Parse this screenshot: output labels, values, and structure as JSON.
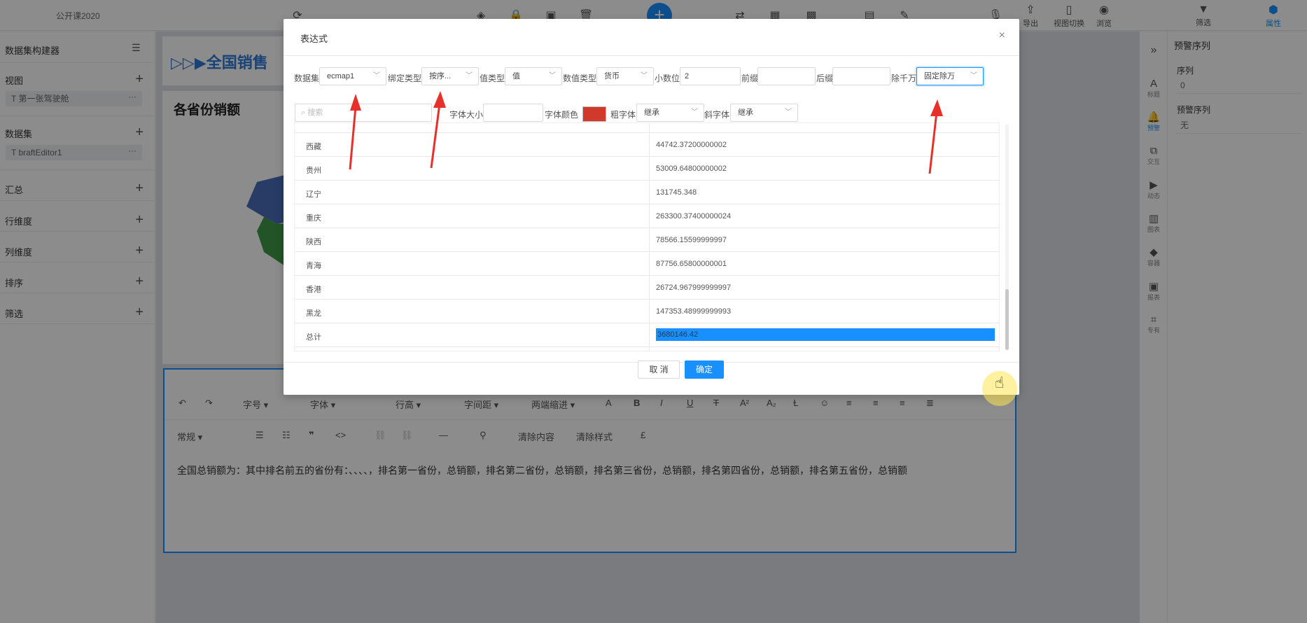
{
  "app": {
    "title": "公开课2020",
    "toolbar_right": [
      {
        "label": "导出"
      },
      {
        "label": "视图切换"
      },
      {
        "label": "浏览"
      },
      {
        "label": "筛选"
      },
      {
        "label": "属性"
      }
    ]
  },
  "left_panel": {
    "title": "数据集构建器",
    "sections": {
      "view": "视图",
      "view_item": "第一张驾驶舱",
      "dataset": "数据集",
      "dataset_item": "braftEditor1",
      "summary": "汇总",
      "row_dim": "行维度",
      "col_dim": "列维度",
      "sort": "排序",
      "filter": "筛选"
    }
  },
  "canvas": {
    "banner": "▷▷▶全国销售",
    "chart_title": "各省份销额"
  },
  "editor": {
    "toolbar_row1": [
      "字号",
      "字体",
      "行高",
      "字间距",
      "两端缩进"
    ],
    "toolbar_row2": [
      "常规",
      "清除内容",
      "清除样式"
    ],
    "content": "全国总销额为：其中排名前五的省份有：、、、、，排名第一省份，总销额，排名第二省份，总销额，排名第三省份，总销额，排名第四省份，总销额，排名第五省份，总销额"
  },
  "right_panel": {
    "title": "预警序列",
    "strip": [
      "标题",
      "预警",
      "交互",
      "动态",
      "图表",
      "容器",
      "报表",
      "专有"
    ],
    "fields": [
      {
        "label": "序列",
        "value": "0"
      },
      {
        "label": "预警序列",
        "value": "无"
      }
    ]
  },
  "modal": {
    "title": "表达式",
    "close_icon": "×",
    "fields": {
      "dataset_label": "数据集",
      "dataset_value": "ecmap1",
      "bind_label": "绑定类型",
      "bind_value": "按序...",
      "valuetype_label": "值类型",
      "valuetype_value": "值",
      "numtype_label": "数值类型",
      "numtype_value": "货币",
      "decimal_label": "小数位",
      "decimal_value": "2",
      "prefix_label": "前缀",
      "suffix_label": "后缀",
      "divide_label": "除千万",
      "divide_value": "固定除万",
      "search_placeholder": "搜索",
      "fontsize_label": "字体大小",
      "fontcolor_label": "字体颜色",
      "bold_label": "粗字体",
      "bold_value": "继承",
      "italic_label": "斜字体",
      "italic_value": "继承"
    },
    "rows": [
      {
        "name": "西藏",
        "value": "44742.37200000002"
      },
      {
        "name": "贵州",
        "value": "53009.64800000002"
      },
      {
        "name": "辽宁",
        "value": "131745.348"
      },
      {
        "name": "重庆",
        "value": "263300.37400000024"
      },
      {
        "name": "陕西",
        "value": "78566.15599999997"
      },
      {
        "name": "青海",
        "value": "87756.65800000001"
      },
      {
        "name": "香港",
        "value": "26724.967999999997"
      },
      {
        "name": "黑龙",
        "value": "147353.48999999993"
      }
    ],
    "total": {
      "name": "总计",
      "value": "3680146.42"
    },
    "cancel_label": "取 消",
    "ok_label": "确定"
  },
  "colors": {
    "accent": "#1890ff",
    "font_color_swatch": "#d13a2a",
    "annotation_arrow": "#e8302a"
  }
}
